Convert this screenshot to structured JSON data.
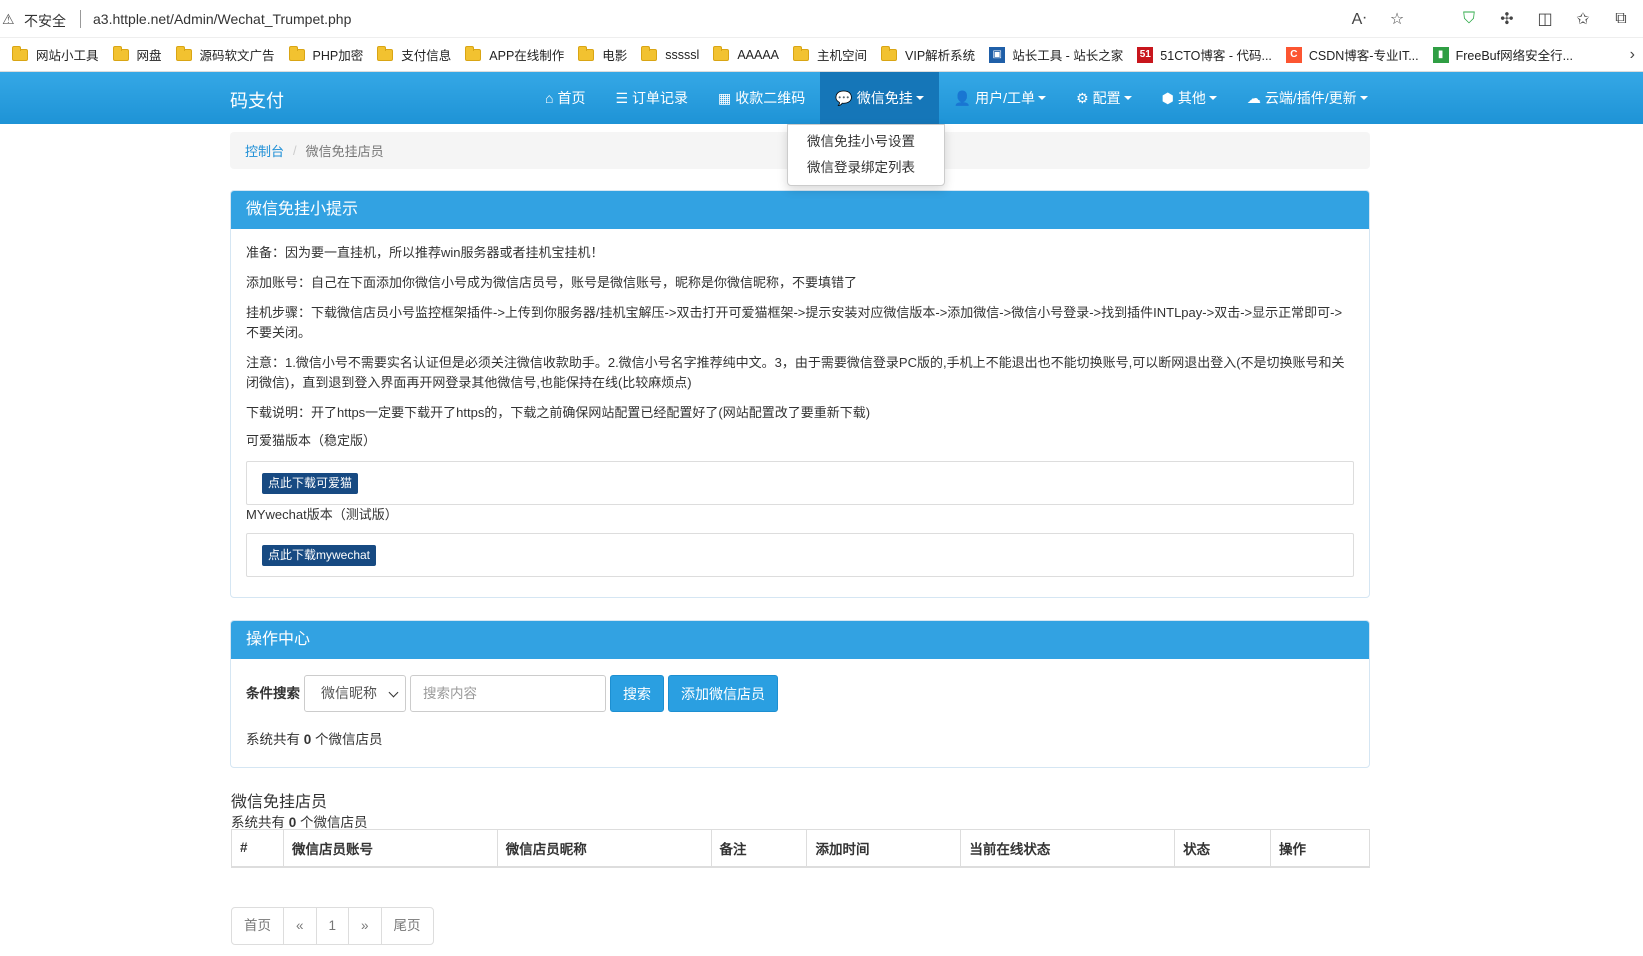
{
  "browser": {
    "insecure_label": "不安全",
    "url": "a3.httple.net/Admin/Wechat_Trumpet.php",
    "icons": [
      "read-aloud-icon",
      "star-icon",
      "shield-icon",
      "extensions-icon",
      "split-screen-icon",
      "favorites-icon",
      "collections-icon"
    ]
  },
  "bookmarks": [
    {
      "label": "网站小工具",
      "icon": "folder"
    },
    {
      "label": "网盘",
      "icon": "folder"
    },
    {
      "label": "源码软文广告",
      "icon": "folder"
    },
    {
      "label": "PHP加密",
      "icon": "folder"
    },
    {
      "label": "支付信息",
      "icon": "folder"
    },
    {
      "label": "APP在线制作",
      "icon": "folder"
    },
    {
      "label": "电影",
      "icon": "folder"
    },
    {
      "label": "sssssl",
      "icon": "folder"
    },
    {
      "label": "AAAAA",
      "icon": "folder"
    },
    {
      "label": "主机空间",
      "icon": "folder"
    },
    {
      "label": "VIP解析系统",
      "icon": "folder"
    },
    {
      "label": "站长工具 - 站长之家",
      "icon": "chinaz",
      "color": "#1f5fa8"
    },
    {
      "label": "51CTO博客 - 代码...",
      "icon": "51cto",
      "color": "#c8161d"
    },
    {
      "label": "CSDN博客-专业IT...",
      "icon": "csdn",
      "color": "#fc5531"
    },
    {
      "label": "FreeBuf网络安全行...",
      "icon": "freebuf",
      "color": "#2f9e44"
    }
  ],
  "navbar": {
    "brand": "码支付",
    "items": [
      {
        "label": "首页",
        "icon": "home-icon",
        "glyph": "⌂",
        "dropdown": false
      },
      {
        "label": "订单记录",
        "icon": "list-icon",
        "glyph": "☰",
        "dropdown": false
      },
      {
        "label": "收款二维码",
        "icon": "qrcode-icon",
        "glyph": "▦",
        "dropdown": false
      },
      {
        "label": "微信免挂",
        "icon": "wechat-icon",
        "glyph": "💬",
        "dropdown": true,
        "active": true
      },
      {
        "label": "用户/工单",
        "icon": "user-icon",
        "glyph": "👤",
        "dropdown": true
      },
      {
        "label": "配置",
        "icon": "gear-icon",
        "glyph": "⚙",
        "dropdown": true
      },
      {
        "label": "其他",
        "icon": "cube-icon",
        "glyph": "⬢",
        "dropdown": true
      },
      {
        "label": "云端/插件/更新",
        "icon": "cloud-icon",
        "glyph": "☁",
        "dropdown": true
      }
    ],
    "dropdown_items": [
      "微信免挂小号设置",
      "微信登录绑定列表"
    ]
  },
  "breadcrumb": {
    "home": "控制台",
    "current": "微信免挂店员"
  },
  "tips_panel": {
    "title": "微信免挂小提示",
    "lines": [
      "准备：因为要一直挂机，所以推荐win服务器或者挂机宝挂机！",
      "添加账号：自己在下面添加你微信小号成为微信店员号，账号是微信账号，昵称是你微信昵称，不要填错了",
      "挂机步骤：下载微信店员小号监控框架插件->上传到你服务器/挂机宝解压->双击打开可爱猫框架->提示安装对应微信版本->添加微信->微信小号登录->找到插件INTLpay->双击->显示正常即可->不要关闭。",
      "注意：1.微信小号不需要实名认证但是必须关注微信收款助手。2.微信小号名字推荐纯中文。3，由于需要微信登录PC版的,手机上不能退出也不能切换账号,可以断网退出登入(不是切换账号和关闭微信)，直到退到登入界面再开网登录其他微信号,也能保持在线(比较麻烦点)",
      "下载说明：开了https一定要下载开了https的，下载之前确保网站配置已经配置好了(网站配置改了要重新下载)"
    ],
    "version1_label": "可爱猫版本（稳定版）",
    "version1_button": "点此下载可爱猫",
    "version2_label": "MYwechat版本（测试版）",
    "version2_button": "点此下载mywechat"
  },
  "ops_panel": {
    "title": "操作中心",
    "search_label": "条件搜索",
    "select_value": "微信昵称",
    "search_placeholder": "搜索内容",
    "search_button": "搜索",
    "add_button": "添加微信店员",
    "count_prefix": "系统共有 ",
    "count": "0",
    "count_suffix": " 个微信店员"
  },
  "table": {
    "title": "微信免挂店员",
    "count_prefix": "系统共有 ",
    "count": "0",
    "count_suffix": " 个微信店员",
    "columns": [
      "#",
      "微信店员账号",
      "微信店员昵称",
      "备注",
      "添加时间",
      "当前在线状态",
      "状态",
      "操作"
    ]
  },
  "pagination": [
    "首页",
    "«",
    "1",
    "»",
    "尾页"
  ]
}
